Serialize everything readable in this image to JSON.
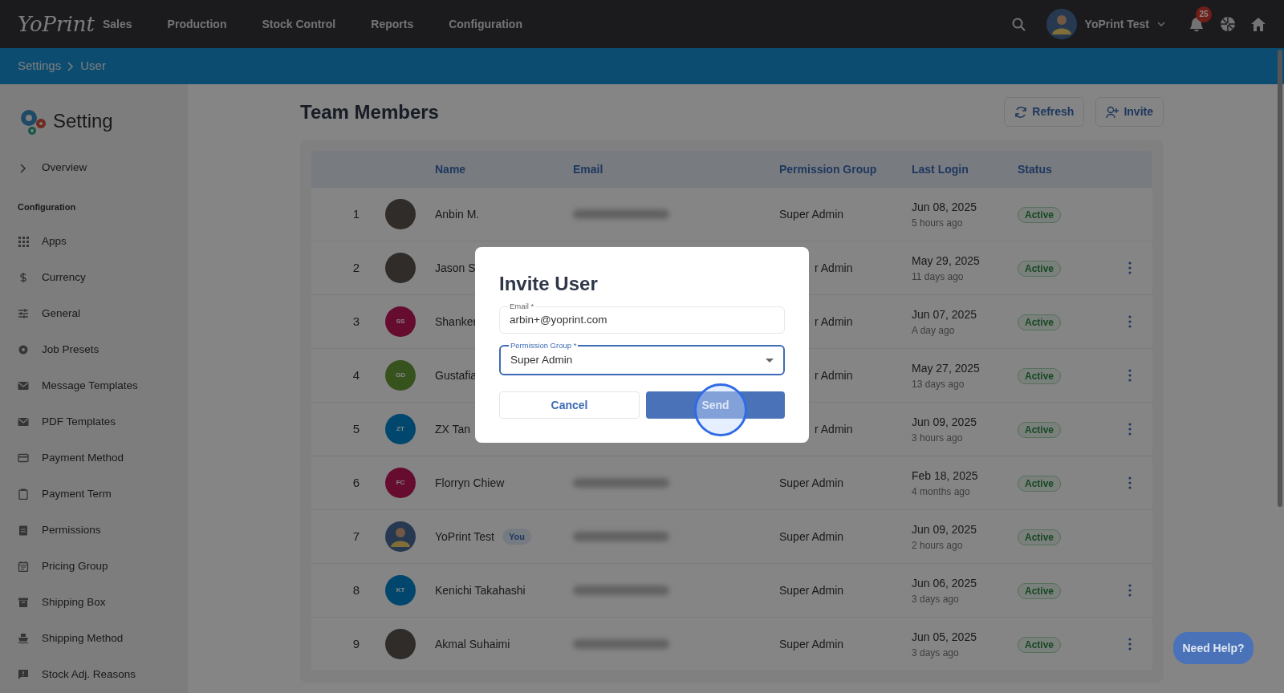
{
  "navbar": {
    "logo": "YoPrint",
    "menu": [
      "Sales",
      "Production",
      "Stock Control",
      "Reports",
      "Configuration"
    ],
    "user": "YoPrint Test",
    "notification_count": "25"
  },
  "breadcrumb": [
    "Settings",
    "User"
  ],
  "sidebar": {
    "title": "Setting",
    "overview": "Overview",
    "section": "Configuration",
    "items": [
      "Apps",
      "Currency",
      "General",
      "Job Presets",
      "Message Templates",
      "PDF Templates",
      "Payment Method",
      "Payment Term",
      "Permissions",
      "Pricing Group",
      "Shipping Box",
      "Shipping Method",
      "Stock Adj. Reasons"
    ]
  },
  "page": {
    "title": "Team Members",
    "buttons": [
      {
        "kind": "refresh",
        "label": "Refresh"
      },
      {
        "kind": "invite",
        "label": "Invite"
      }
    ]
  },
  "table": {
    "columns": [
      "Name",
      "Email",
      "Permission Group",
      "Last Login",
      "Status"
    ],
    "rows": [
      {
        "number": "1",
        "avatar": {
          "kind": "photo"
        },
        "name": "Anbin M.",
        "permission": "Super Admin",
        "under_dialog": false,
        "last_login": "Jun 08, 2025",
        "ago": "5 hours ago",
        "status": "Active",
        "menu": false
      },
      {
        "number": "2",
        "avatar": {
          "kind": "photo"
        },
        "name": "Jason S",
        "permission": "r Admin",
        "under_dialog": true,
        "last_login": "May 29, 2025",
        "ago": "11 days ago",
        "status": "Active",
        "menu": true
      },
      {
        "number": "3",
        "avatar": {
          "kind": "initials",
          "text": "SS"
        },
        "name": "Shanker",
        "permission": "r Admin",
        "under_dialog": true,
        "last_login": "Jun 07, 2025",
        "ago": "A day ago",
        "status": "Active",
        "menu": true
      },
      {
        "number": "4",
        "avatar": {
          "kind": "initials",
          "text": "GD"
        },
        "name": "Gustafia",
        "permission": "r Admin",
        "under_dialog": true,
        "last_login": "May 27, 2025",
        "ago": "13 days ago",
        "status": "Active",
        "menu": true
      },
      {
        "number": "5",
        "avatar": {
          "kind": "initials",
          "text": "ZT"
        },
        "name": "ZX Tan",
        "permission": "r Admin",
        "under_dialog": true,
        "last_login": "Jun 09, 2025",
        "ago": "3 hours ago",
        "status": "Active",
        "menu": true
      },
      {
        "number": "6",
        "avatar": {
          "kind": "initials",
          "text": "FC"
        },
        "name": "Florryn Chiew",
        "permission": "Super Admin",
        "under_dialog": false,
        "last_login": "Feb 18, 2025",
        "ago": "4 months ago",
        "status": "Active",
        "menu": true
      },
      {
        "number": "7",
        "avatar": {
          "kind": "silhouette"
        },
        "name": "YoPrint Test",
        "tag": "You",
        "permission": "Super Admin",
        "under_dialog": false,
        "last_login": "Jun 09, 2025",
        "ago": "2 hours ago",
        "status": "Active",
        "menu": false
      },
      {
        "number": "8",
        "avatar": {
          "kind": "initials",
          "text": "KT"
        },
        "name": "Kenichi Takahashi",
        "permission": "Super Admin",
        "under_dialog": false,
        "last_login": "Jun 06, 2025",
        "ago": "3 days ago",
        "status": "Active",
        "menu": true
      },
      {
        "number": "9",
        "avatar": {
          "kind": "photo"
        },
        "name": "Akmal Suhaimi",
        "permission": "Super Admin",
        "under_dialog": false,
        "last_login": "Jun 05, 2025",
        "ago": "3 days ago",
        "status": "Active",
        "menu": true
      }
    ]
  },
  "dialog": {
    "title": "Invite User",
    "fields": [
      {
        "label": "Email *",
        "value": "arbin+@yoprint.com",
        "kind": "text",
        "focused": false
      },
      {
        "label": "Permission Group *",
        "value": "Super Admin",
        "kind": "select",
        "focused": true
      }
    ],
    "buttons": [
      {
        "kind": "secondary",
        "label": "Cancel"
      },
      {
        "kind": "primary",
        "label": "Send"
      }
    ]
  },
  "help_button": "Need Help?"
}
